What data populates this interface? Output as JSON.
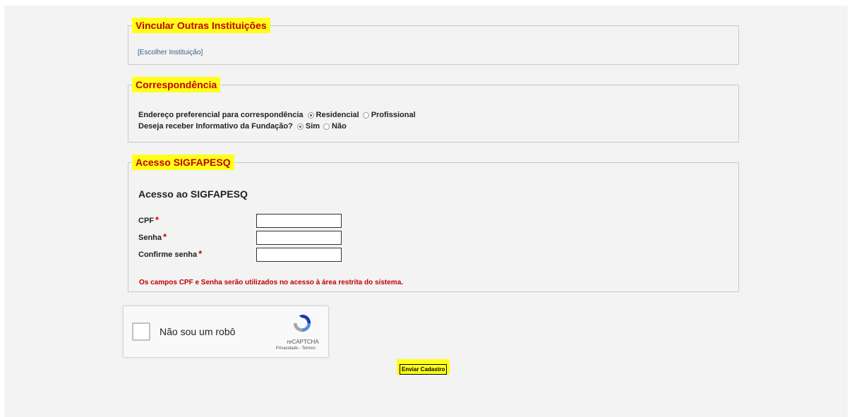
{
  "vincular": {
    "legend": "Vincular Outras Instituições",
    "link": "[Escolher Instituição]"
  },
  "correspondencia": {
    "legend": "Correspondência",
    "endereco_label": "Endereço preferencial para correspondência",
    "endereco_options": [
      "Residencial",
      "Profissional"
    ],
    "endereco_selected": "Residencial",
    "informativo_label": "Deseja receber Informativo da Fundação?",
    "informativo_options": [
      "Sim",
      "Não"
    ],
    "informativo_selected": "Sim"
  },
  "acesso": {
    "legend": "Acesso SIGFAPESQ",
    "title": "Acesso ao SIGFAPESQ",
    "cpf_label": "CPF",
    "senha_label": "Senha",
    "confirme_label": "Confirme senha",
    "required_mark": "*",
    "cpf_value": "",
    "senha_value": "",
    "confirme_value": "",
    "note": "Os campos CPF e Senha serão utilizados no acesso à área restrita do sistema."
  },
  "captcha": {
    "label": "Não sou um robô",
    "brand": "reCAPTCHA",
    "links": "Privacidade - Termos"
  },
  "submit": {
    "label": "Enviar Cadastro"
  },
  "colors": {
    "highlight": "#ffff1a",
    "legend_text": "#c00000",
    "note_text": "#c00000",
    "background": "#f2f3f2"
  }
}
